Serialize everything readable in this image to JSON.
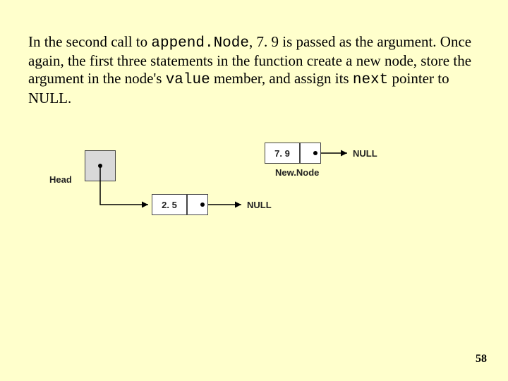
{
  "paragraph": {
    "p1_a": "In the second call to ",
    "p1_code1": "append.Node",
    "p1_b": ", 7. 9 is passed as the argument. Once again, the first three statements in the function create a new node, store the argument in the node's ",
    "p1_code2": "value",
    "p1_c": " member, and assign its ",
    "p1_code3": "next",
    "p1_d": " pointer to NULL."
  },
  "diagram": {
    "head_label": "Head",
    "newnode_label": "New.Node",
    "node1_value": "2. 5",
    "node2_value": "7. 9",
    "null1": "NULL",
    "null2": "NULL"
  },
  "page_number": "58"
}
